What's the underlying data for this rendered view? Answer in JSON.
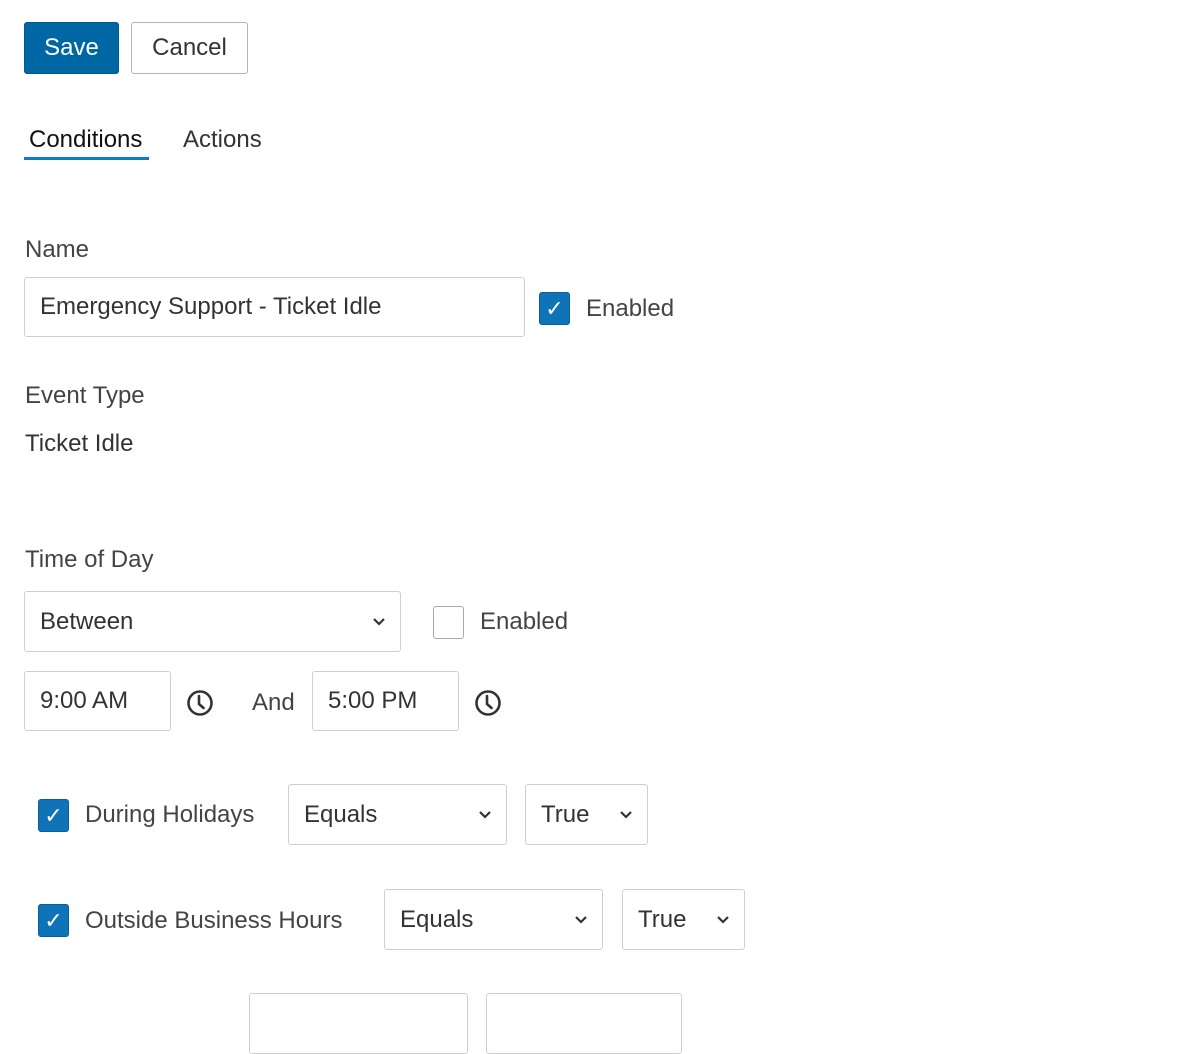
{
  "toolbar": {
    "save_label": "Save",
    "cancel_label": "Cancel"
  },
  "tabs": [
    {
      "label": "Conditions",
      "active": true
    },
    {
      "label": "Actions",
      "active": false
    }
  ],
  "name_section": {
    "label": "Name",
    "value": "Emergency Support - Ticket Idle",
    "enabled_label": "Enabled",
    "enabled_checked": true
  },
  "event_type": {
    "label": "Event Type",
    "value": "Ticket Idle"
  },
  "time_of_day": {
    "label": "Time of Day",
    "operator": "Between",
    "enabled_label": "Enabled",
    "enabled_checked": false,
    "start_time": "9:00 AM",
    "and_label": "And",
    "end_time": "5:00 PM",
    "clock_icon": "clock-icon"
  },
  "conditions": [
    {
      "label": "During Holidays",
      "checked": true,
      "operator": "Equals",
      "value": "True"
    },
    {
      "label": "Outside Business Hours",
      "checked": true,
      "operator": "Equals",
      "value": "True"
    }
  ],
  "colors": {
    "primary": "#0067a5",
    "checkbox": "#0f73b8",
    "tab_underline": "#0f7cc4",
    "border": "#cfcfcf"
  }
}
